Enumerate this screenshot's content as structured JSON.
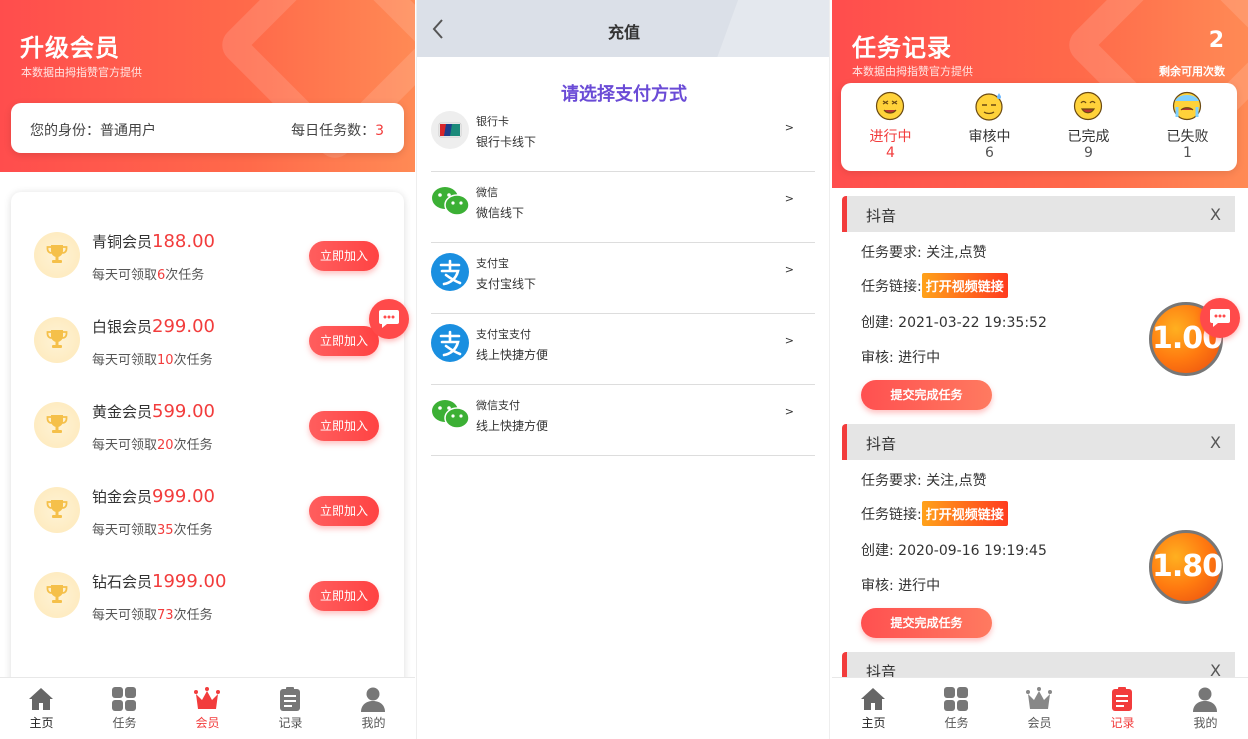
{
  "vip": {
    "title": "升级会员",
    "subtitle": "本数据由拇指赞官方提供",
    "identity_label": "您的身份：普通用户",
    "daily_label": "每日任务数：",
    "daily_value": "3",
    "levels": [
      {
        "name": "青铜会员",
        "price": "188.00",
        "desc_pre": "每天可领取",
        "count": "6",
        "desc_post": "次任务",
        "join": "立即加入"
      },
      {
        "name": "白银会员",
        "price": "299.00",
        "desc_pre": "每天可领取",
        "count": "10",
        "desc_post": "次任务",
        "join": "立即加入"
      },
      {
        "name": "黄金会员",
        "price": "599.00",
        "desc_pre": "每天可领取",
        "count": "20",
        "desc_post": "次任务",
        "join": "立即加入"
      },
      {
        "name": "铂金会员",
        "price": "999.00",
        "desc_pre": "每天可领取",
        "count": "35",
        "desc_post": "次任务",
        "join": "立即加入"
      },
      {
        "name": "钻石会员",
        "price": "1999.00",
        "desc_pre": "每天可领取",
        "count": "73",
        "desc_post": "次任务",
        "join": "立即加入"
      }
    ]
  },
  "tabs": [
    "主页",
    "任务",
    "会员",
    "记录",
    "我的"
  ],
  "recharge": {
    "title": "充值",
    "heading": "请选择支付方式",
    "methods": [
      {
        "name": "银行卡",
        "sub": "银行卡线下",
        "icon": "unionpay-icon",
        "arrow": ">"
      },
      {
        "name": "微信",
        "sub": "微信线下",
        "icon": "wechat-icon",
        "arrow": ">"
      },
      {
        "name": "支付宝",
        "sub": "支付宝线下",
        "icon": "alipay-icon",
        "arrow": ">"
      },
      {
        "name": "支付宝支付",
        "sub": "线上快捷方便",
        "icon": "alipay-icon",
        "arrow": ">"
      },
      {
        "name": "微信支付",
        "sub": "线上快捷方便",
        "icon": "wechat-icon",
        "arrow": ">"
      }
    ]
  },
  "records": {
    "title": "任务记录",
    "subtitle": "本数据由拇指赞官方提供",
    "remaining_value": "2",
    "remaining_label": "剩余可用次数",
    "statuses": [
      {
        "label": "进行中",
        "count": "4"
      },
      {
        "label": "审核中",
        "count": "6"
      },
      {
        "label": "已完成",
        "count": "9"
      },
      {
        "label": "已失败",
        "count": "1"
      }
    ],
    "tasks": [
      {
        "platform": "抖音",
        "close": "X",
        "requirement": "任务要求: 关注,点赞",
        "link_label": "任务链接:",
        "link_btn": "打开视频链接",
        "created": "创建: 2021-03-22 19:35:52",
        "review": "审核: 进行中",
        "submit": "提交完成任务",
        "reward": "1.00"
      },
      {
        "platform": "抖音",
        "close": "X",
        "requirement": "任务要求: 关注,点赞",
        "link_label": "任务链接:",
        "link_btn": "打开视频链接",
        "created": "创建: 2020-09-16 19:19:45",
        "review": "审核: 进行中",
        "submit": "提交完成任务",
        "reward": "1.80"
      },
      {
        "platform": "抖音",
        "close": "X"
      }
    ]
  },
  "colors": {
    "accent": "#f23c3c",
    "heading_purple": "#6a4bd6",
    "topbar_gray": "#dbe0e8"
  }
}
